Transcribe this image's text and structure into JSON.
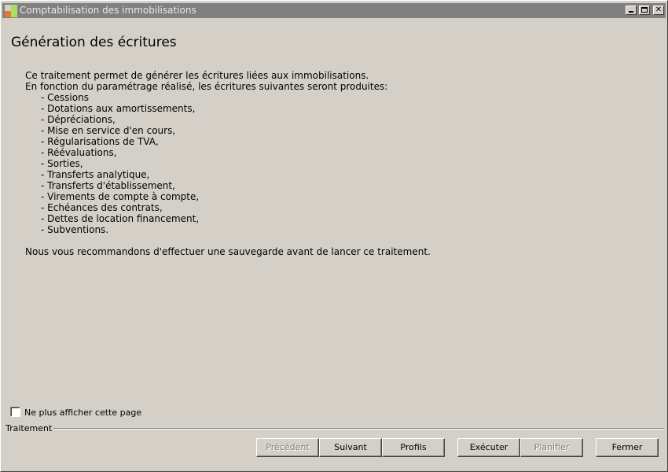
{
  "window": {
    "title": "Comptabilisation des immobilisations",
    "icon": "app-window-icon"
  },
  "page": {
    "title": "Génération des écritures",
    "intro_line1": "Ce traitement permet de générer les écritures liées aux immobilisations.",
    "intro_line2": "En fonction du paramétrage réalisé, les écritures suivantes seront produites:",
    "items": [
      "- Cessions",
      "- Dotations aux amortissements,",
      "- Dépréciations,",
      "- Mise en service d'en cours,",
      "- Régularisations de TVA,",
      "- Réévaluations,",
      "- Sorties,",
      "- Transferts analytique,",
      "- Transferts d'établissement,",
      "- Virements de compte à compte,",
      "- Echéances des contrats,",
      "- Dettes de location financement,",
      "- Subventions."
    ],
    "recommendation": "Nous vous recommandons d'effectuer une sauvegarde avant de lancer ce traitement."
  },
  "options": {
    "hide_page_label": "Ne plus afficher cette page",
    "hide_page_checked": false
  },
  "group": {
    "label": "Traitement"
  },
  "buttons": {
    "previous": "Précédent",
    "next": "Suivant",
    "profiles": "Profils",
    "execute": "Exécuter",
    "schedule": "Planifier",
    "close": "Fermer"
  }
}
